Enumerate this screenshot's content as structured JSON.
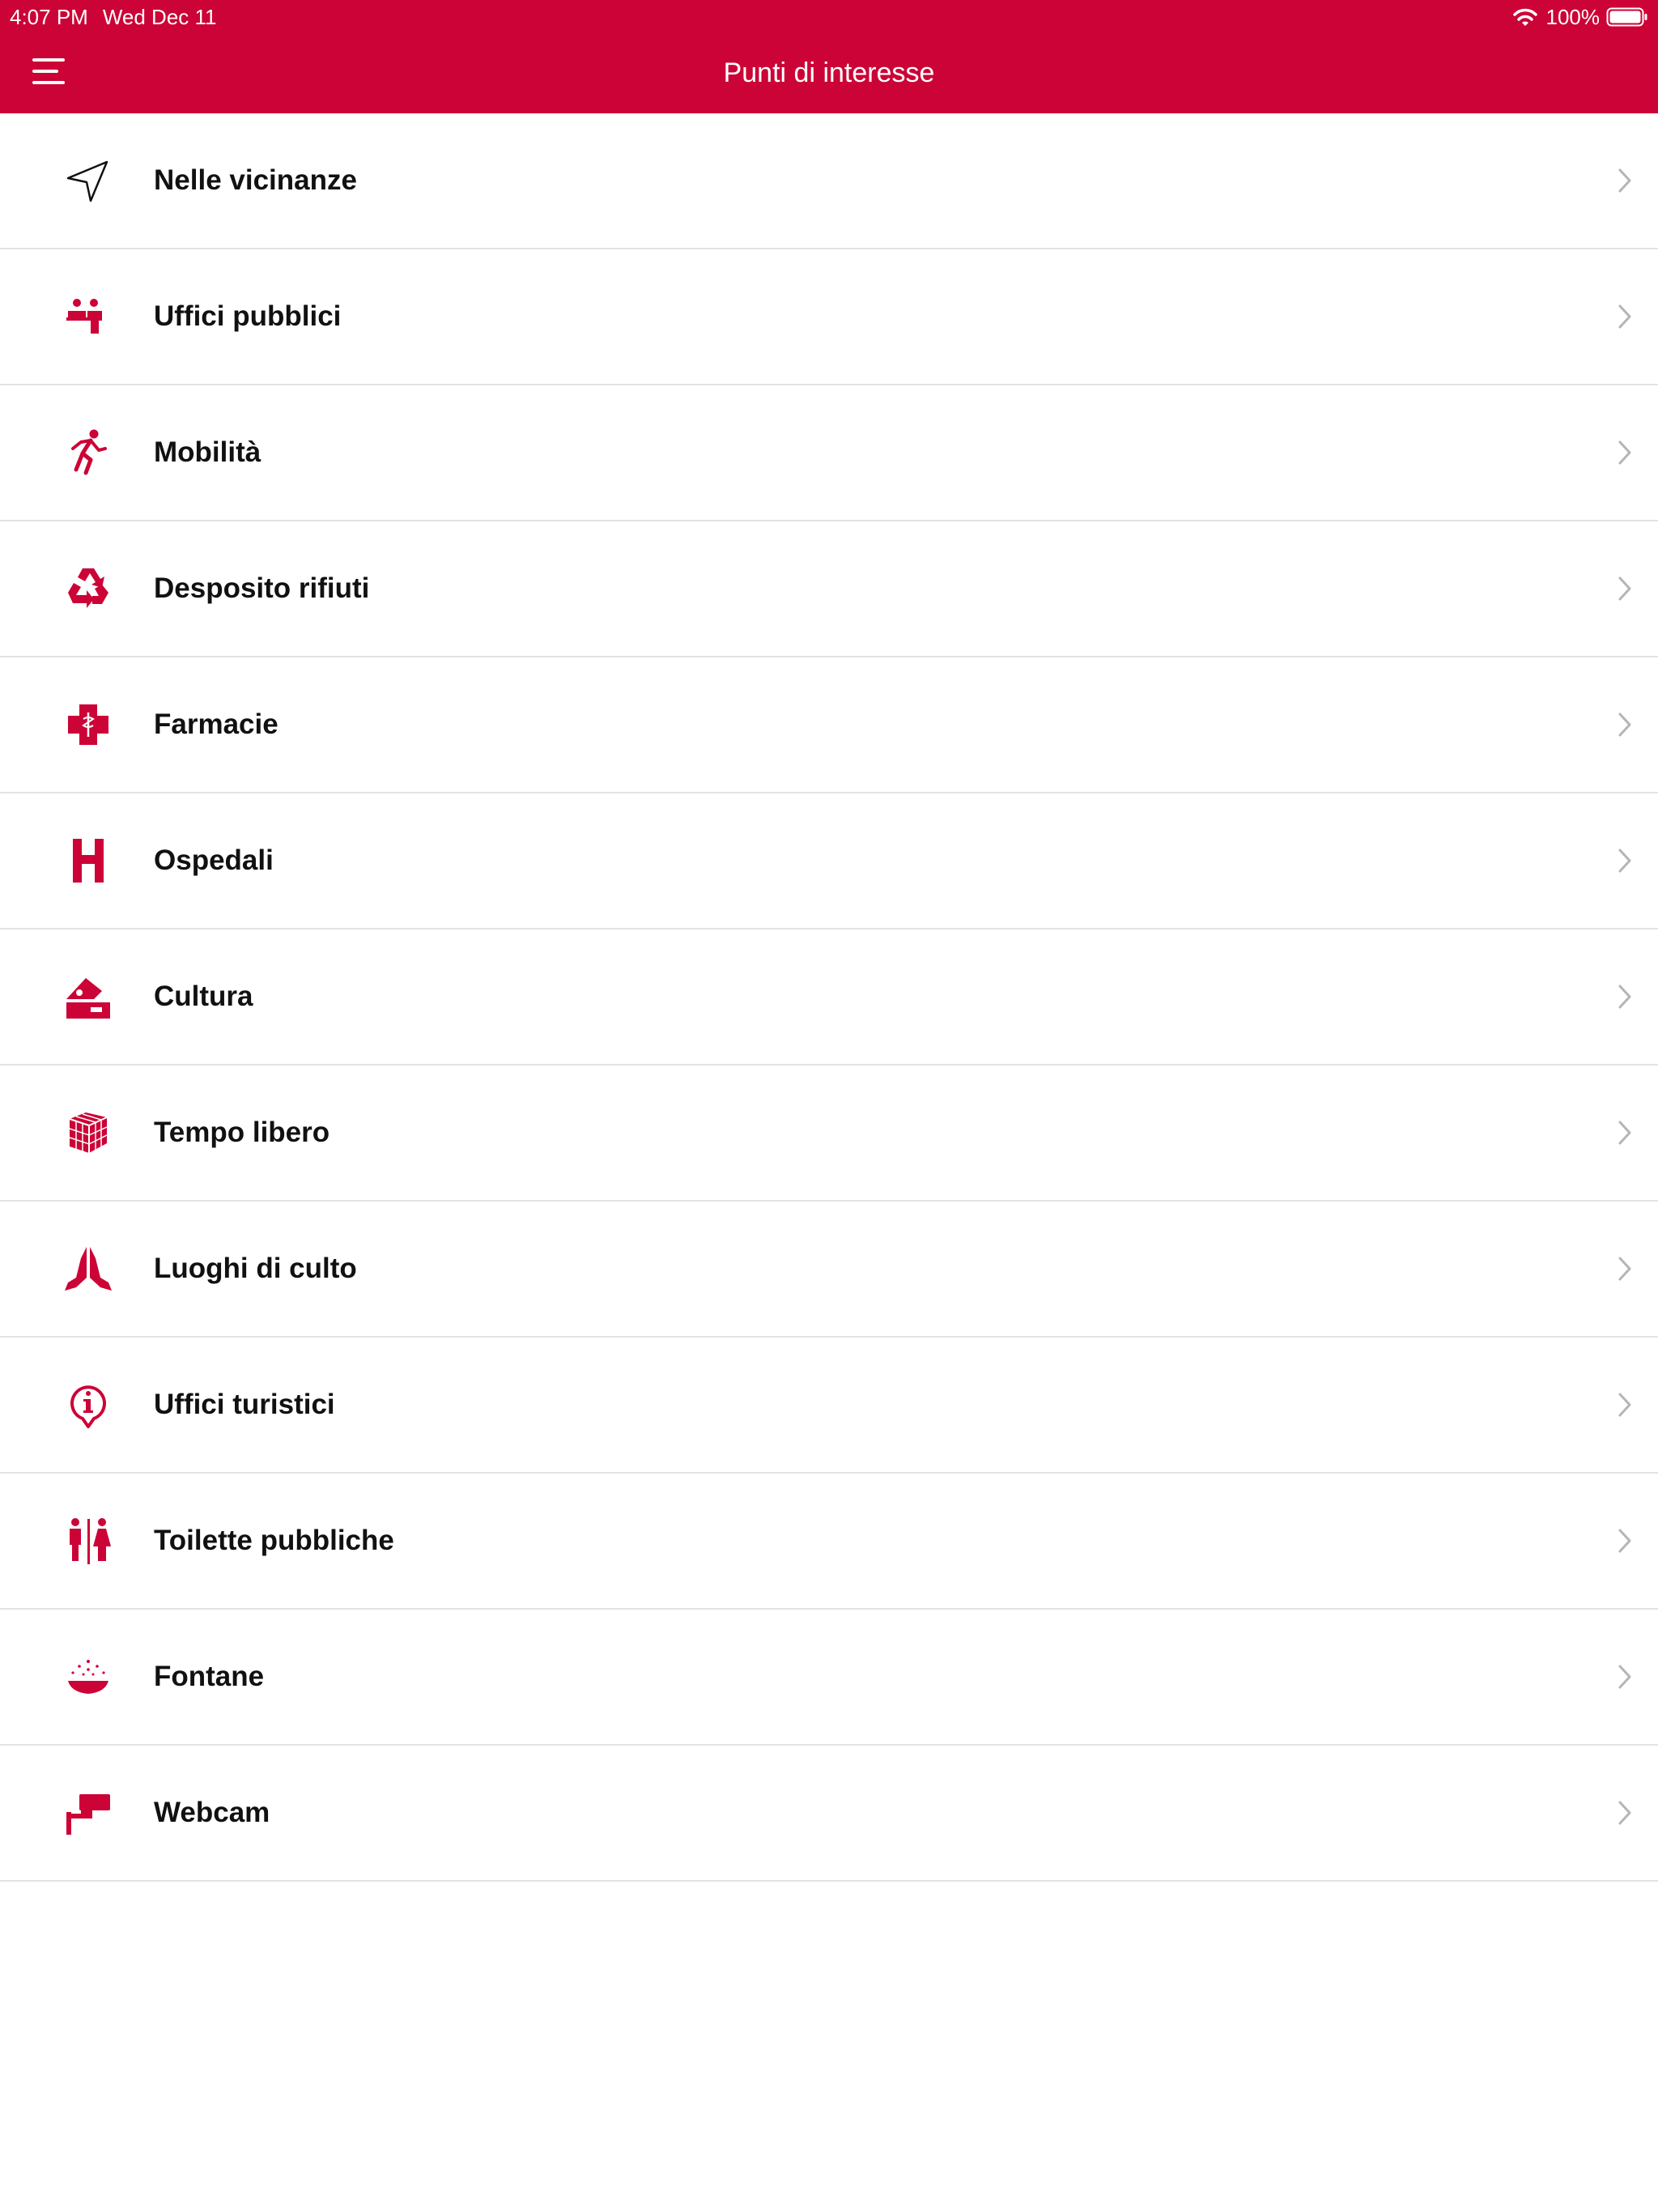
{
  "status_bar": {
    "time": "4:07 PM",
    "date": "Wed Dec 11",
    "battery": "100%"
  },
  "header": {
    "title": "Punti di interesse",
    "menu_icon": "hamburger-menu-icon"
  },
  "colors": {
    "accent": "#cc0336",
    "text": "#111111",
    "divider": "#e3e3e3",
    "chevron": "#b5b5b5"
  },
  "items": [
    {
      "label": "Nelle vicinanze",
      "icon": "location-arrow-icon"
    },
    {
      "label": "Uffici pubblici",
      "icon": "people-office-icon"
    },
    {
      "label": "Mobilità",
      "icon": "running-person-icon"
    },
    {
      "label": "Desposito rifiuti",
      "icon": "recycle-icon"
    },
    {
      "label": "Farmacie",
      "icon": "pharmacy-cross-icon"
    },
    {
      "label": "Ospedali",
      "icon": "hospital-h-icon"
    },
    {
      "label": "Cultura",
      "icon": "culture-icon"
    },
    {
      "label": "Tempo libero",
      "icon": "rubik-cube-icon"
    },
    {
      "label": "Luoghi di culto",
      "icon": "praying-hands-icon"
    },
    {
      "label": "Uffici turistici",
      "icon": "info-pin-icon"
    },
    {
      "label": "Toilette pubbliche",
      "icon": "toilet-icon"
    },
    {
      "label": "Fontane",
      "icon": "fountain-icon"
    },
    {
      "label": "Webcam",
      "icon": "webcam-icon"
    }
  ]
}
